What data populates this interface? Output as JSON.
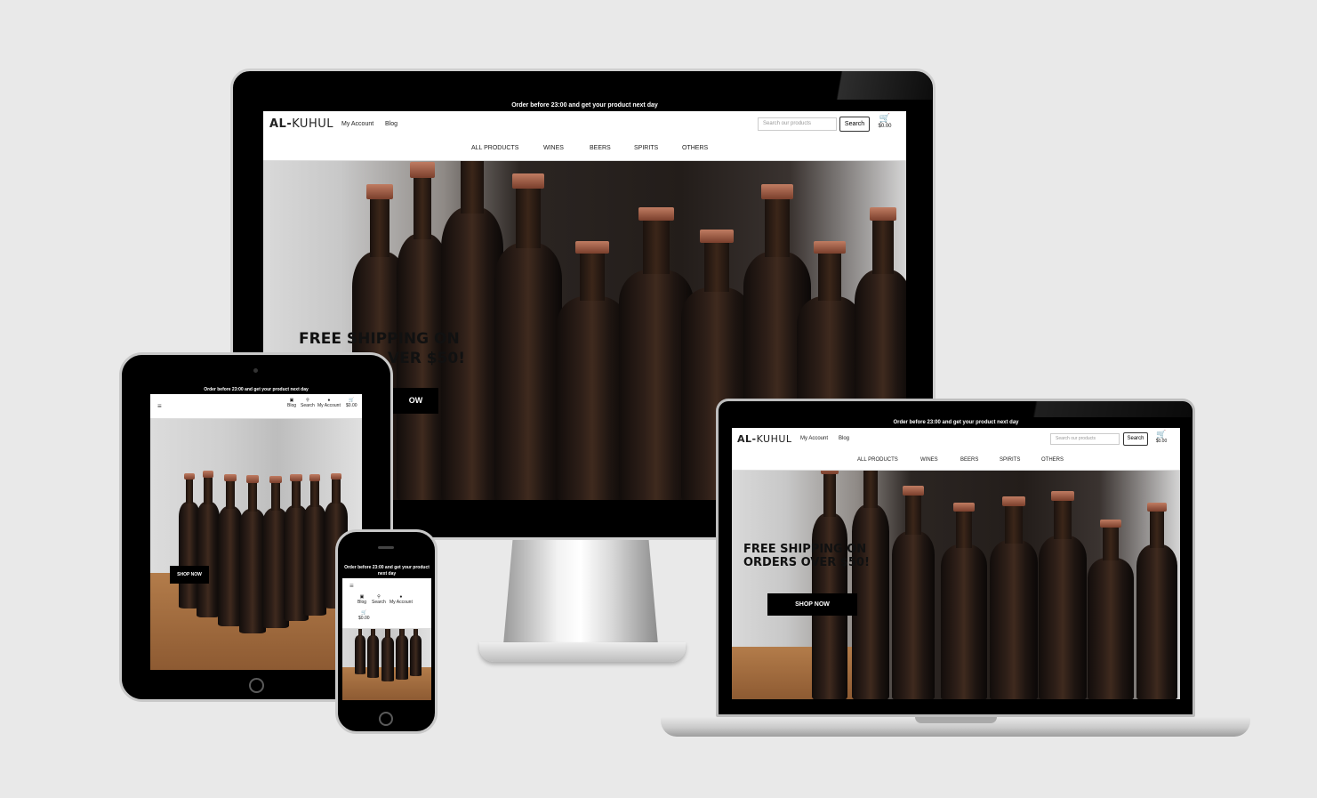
{
  "site": {
    "banner": "Order before 23:00 and get your product next day",
    "banner_phone_line1": "Order before 23:00 and get your product",
    "banner_phone_line2": "next day",
    "logo_prefix": "AL-",
    "logo_rest": "KUHUL",
    "my_account": "My Account",
    "blog": "Blog",
    "search_placeholder": "Search our products",
    "search_button": "Search",
    "cart_total": "$0.00",
    "nav": [
      "ALL PRODUCTS",
      "WINES",
      "BEERS",
      "SPIRITS",
      "OTHERS"
    ],
    "hero_line1": "FREE SHIPPING ON",
    "hero_line2": "ORDERS OVER $50!",
    "monitor_hero_line2_visible": "VER $50!",
    "monitor_shop_visible": "OW",
    "shop_now": "SHOP NOW",
    "mobile_icons": {
      "blog": "Blog",
      "search": "Search",
      "account": "My Account",
      "cart": "$0.00"
    },
    "icons": {
      "cart": "cart-icon",
      "menu": "hamburger-menu-icon",
      "search": "search-icon",
      "account": "user-icon",
      "blog": "blog-icon"
    }
  }
}
